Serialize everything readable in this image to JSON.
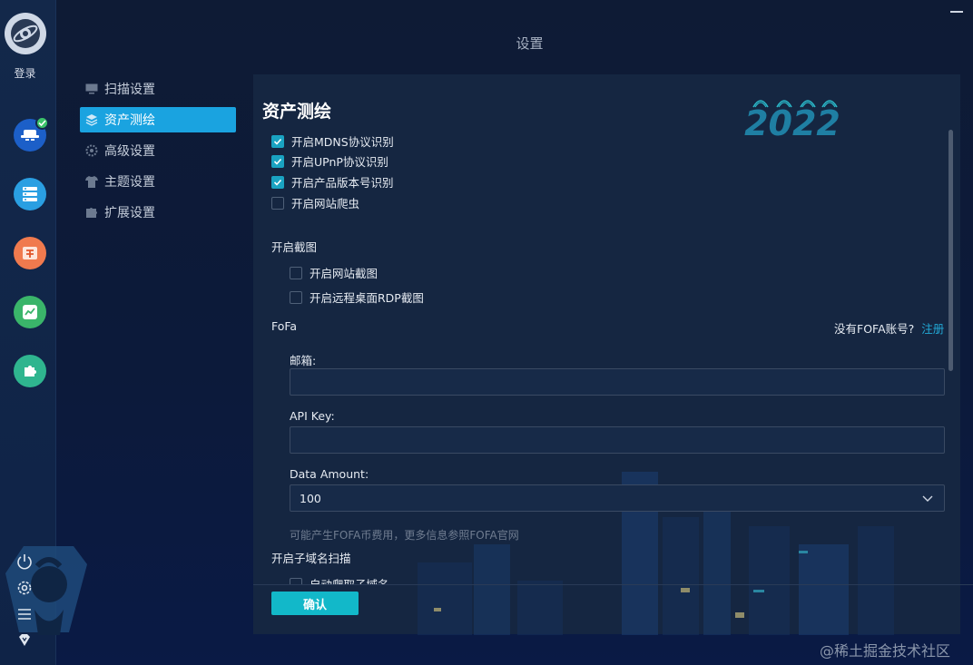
{
  "window": {
    "title": "设置"
  },
  "rail": {
    "login_label": "登录",
    "apps": [
      {
        "icon": "hacker-hat-icon",
        "color": "#1c5fc8",
        "badge": true
      },
      {
        "icon": "server-list-icon",
        "color": "#2a9fe2",
        "badge": false
      },
      {
        "icon": "vuln-app-icon",
        "color": "#f07a4e",
        "badge": false
      },
      {
        "icon": "trend-chart-icon",
        "color": "#3ab56a",
        "badge": false
      },
      {
        "icon": "puzzle-icon",
        "color": "#2fb58f",
        "badge": false
      }
    ]
  },
  "nav": {
    "items": [
      {
        "label": "扫描设置",
        "icon": "monitor-icon",
        "active": false
      },
      {
        "label": "资产测绘",
        "icon": "layers-icon",
        "active": true
      },
      {
        "label": "高级设置",
        "icon": "gear-icon",
        "active": false
      },
      {
        "label": "主题设置",
        "icon": "shirt-icon",
        "active": false
      },
      {
        "label": "扩展设置",
        "icon": "puzzle-piece-icon",
        "active": false
      }
    ]
  },
  "section": {
    "title": "资产测绘",
    "logo_text": "2022",
    "options": [
      {
        "label": "开启MDNS协议识别",
        "checked": true
      },
      {
        "label": "开启UPnP协议识别",
        "checked": true
      },
      {
        "label": "开启产品版本号识别",
        "checked": true
      },
      {
        "label": "开启网站爬虫",
        "checked": false
      }
    ],
    "screenshot": {
      "heading": "开启截图",
      "options": [
        {
          "label": "开启网站截图",
          "checked": false
        },
        {
          "label": "开启远程桌面RDP截图",
          "checked": false
        }
      ]
    },
    "fofa": {
      "heading": "FoFa",
      "no_account": "没有FOFA账号?",
      "register_link": "注册",
      "email_label": "邮箱:",
      "email_value": "",
      "apikey_label": "API Key:",
      "apikey_value": "",
      "amount_label": "Data Amount:",
      "amount_value": "100",
      "hint": "可能产生FOFA币费用，更多信息参照FOFA官网"
    },
    "subdomain": {
      "heading": "开启子域名扫描",
      "option_partial": "自动爬取子域名"
    }
  },
  "footer": {
    "confirm_label": "确认"
  },
  "watermark": "@稀土掘金技术社区"
}
